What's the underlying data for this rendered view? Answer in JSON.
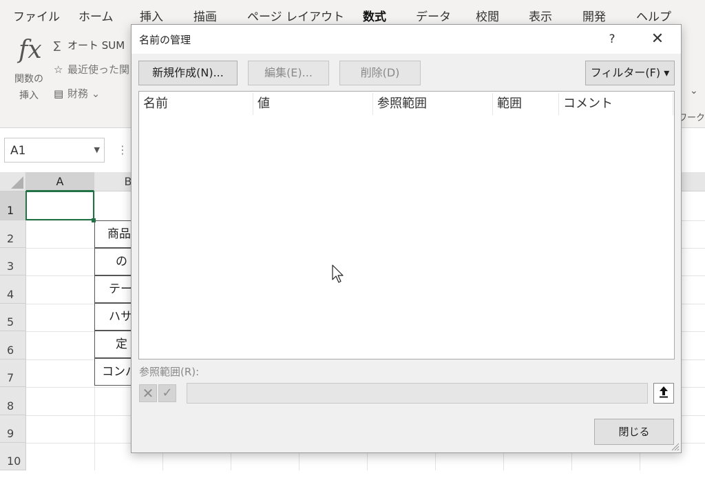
{
  "ribbon": {
    "tabs": [
      "ファイル",
      "ホーム",
      "挿入",
      "描画",
      "ページ レイアウト",
      "数式",
      "データ",
      "校閲",
      "表示",
      "開発",
      "ヘルプ"
    ],
    "active_tab": "数式",
    "fx_glyph": "fx",
    "insert_function_label": "関数の 挿入",
    "autosum_label": "オート SUM",
    "recent_label": "最近使った関",
    "finance_label": "財務 ⌄",
    "right_partial_label": "ワークシ",
    "right_chevron": "⌄"
  },
  "formula_bar": {
    "name_box_value": "A1",
    "dots": "⋮"
  },
  "grid": {
    "columns": [
      "A",
      "B"
    ],
    "rows": [
      "1",
      "2",
      "3",
      "4",
      "5",
      "6",
      "7",
      "8",
      "9",
      "10"
    ],
    "b_cells": [
      "商品",
      "の",
      "テー",
      "ハサ",
      "定",
      "コンパ"
    ]
  },
  "dialog": {
    "title": "名前の管理",
    "help": "?",
    "close": "✕",
    "buttons": {
      "new": "新規作成(N)...",
      "edit": "編集(E)...",
      "delete": "削除(D)",
      "filter": "フィルター(F) ▾"
    },
    "columns": [
      "名前",
      "値",
      "参照範囲",
      "範囲",
      "コメント"
    ],
    "ref_label": "参照範囲(R):",
    "ref_value": "",
    "cancel_icon": "✕",
    "confirm_icon": "✓",
    "collapse_icon": "🠕",
    "close_button": "閉じる"
  }
}
